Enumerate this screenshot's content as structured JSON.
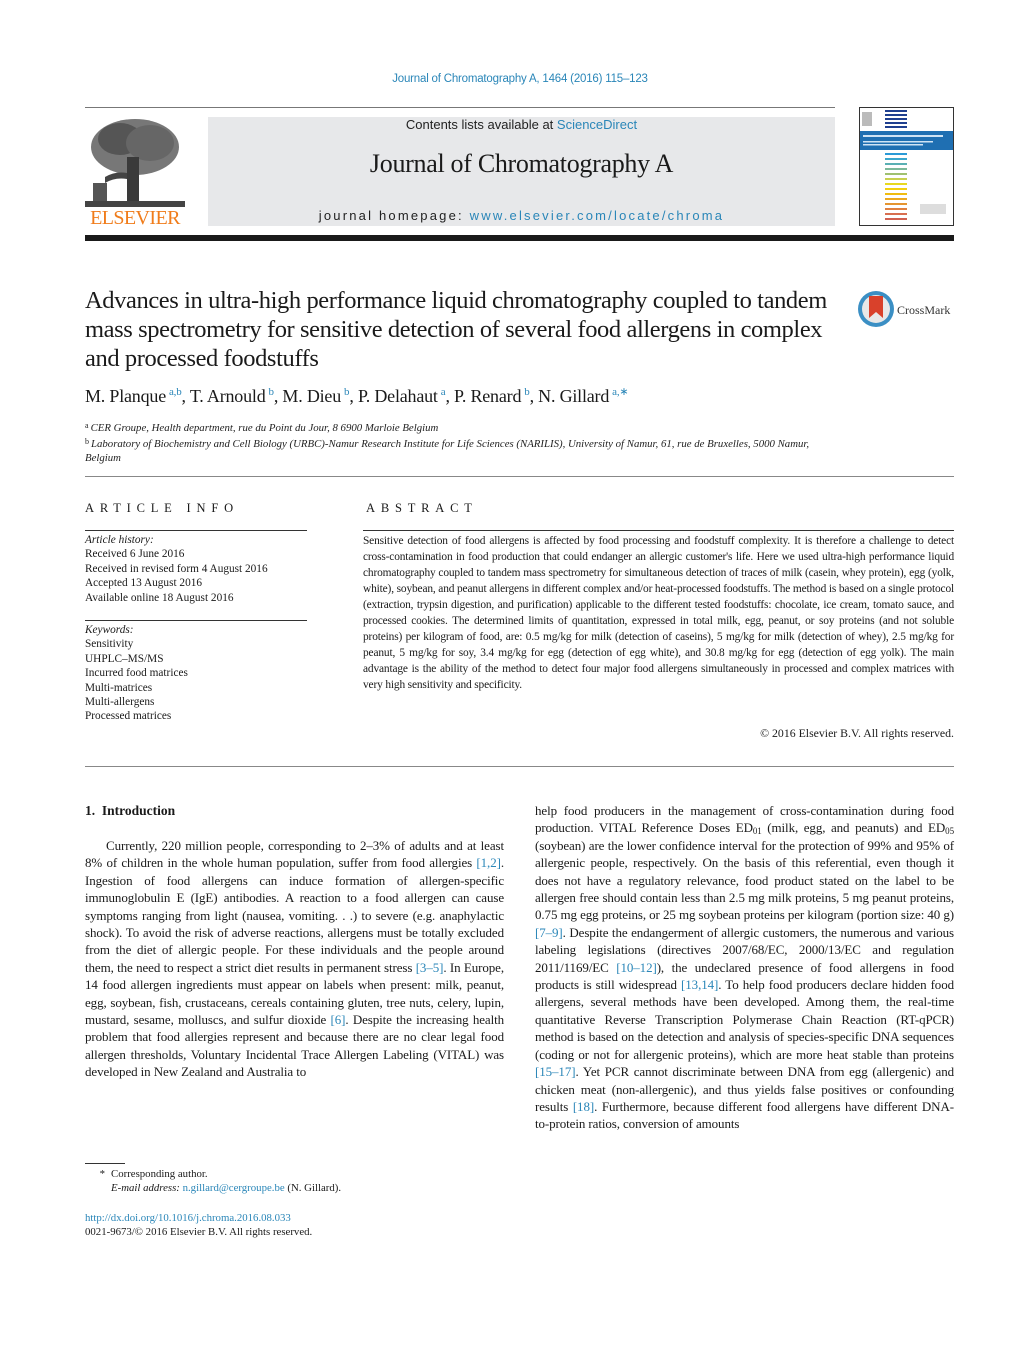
{
  "header": {
    "citation": "Journal of Chromatography A, 1464 (2016) 115–123",
    "publisher_logo_text": "ELSEVIER",
    "contents_prefix": "Contents lists available at ",
    "contents_link": "ScienceDirect",
    "journal_name": "Journal of Chromatography A",
    "homepage_prefix": "journal homepage: ",
    "homepage_link": "www.elsevier.com/locate/chroma",
    "colors": {
      "link": "#2a86b8",
      "elsevier_orange": "#f07c1a",
      "masthead_bg": "#e7e8ea"
    }
  },
  "article": {
    "title": "Advances in ultra-high performance liquid chromatography coupled to tandem mass spectrometry for sensitive detection of several food allergens in complex and processed foodstuffs",
    "crossmark_label": "CrossMark",
    "authors": [
      {
        "name": "M. Planque",
        "aff": "a,b"
      },
      {
        "name": "T. Arnould",
        "aff": "b"
      },
      {
        "name": "M. Dieu",
        "aff": "b"
      },
      {
        "name": "P. Delahaut",
        "aff": "a"
      },
      {
        "name": "P. Renard",
        "aff": "b"
      },
      {
        "name": "N. Gillard",
        "aff": "a,∗"
      }
    ],
    "affiliations": [
      {
        "mark": "a",
        "text": "CER Groupe, Health department, rue du Point du Jour, 8 6900 Marloie Belgium"
      },
      {
        "mark": "b",
        "text": "Laboratory of Biochemistry and Cell Biology (URBC)-Namur Research Institute for Life Sciences (NARILIS), University of Namur, 61, rue de Bruxelles, 5000 Namur, Belgium"
      }
    ]
  },
  "article_info": {
    "heading": "ARTICLE INFO",
    "history_label": "Article history:",
    "history": [
      "Received 6 June 2016",
      "Received in revised form 4 August 2016",
      "Accepted 13 August 2016",
      "Available online 18 August 2016"
    ],
    "keywords_label": "Keywords:",
    "keywords": [
      "Sensitivity",
      "UHPLC–MS/MS",
      "Incurred food matrices",
      "Multi-matrices",
      "Multi-allergens",
      "Processed matrices"
    ]
  },
  "abstract": {
    "heading": "ABSTRACT",
    "text": "Sensitive detection of food allergens is affected by food processing and foodstuff complexity. It is therefore a challenge to detect cross-contamination in food production that could endanger an allergic customer's life. Here we used ultra-high performance liquid chromatography coupled to tandem mass spectrometry for simultaneous detection of traces of milk (casein, whey protein), egg (yolk, white), soybean, and peanut allergens in different complex and/or heat-processed foodstuffs. The method is based on a single protocol (extraction, trypsin digestion, and purification) applicable to the different tested foodstuffs: chocolate, ice cream, tomato sauce, and processed cookies. The determined limits of quantitation, expressed in total milk, egg, peanut, or soy proteins (and not soluble proteins) per kilogram of food, are: 0.5 mg/kg for milk (detection of caseins), 5 mg/kg for milk (detection of whey), 2.5 mg/kg for peanut, 5 mg/kg for soy, 3.4 mg/kg for egg (detection of egg white), and 30.8 mg/kg for egg (detection of egg yolk). The main advantage is the ability of the method to detect four major food allergens simultaneously in processed and complex matrices with very high sensitivity and specificity.",
    "copyright": "© 2016 Elsevier B.V. All rights reserved."
  },
  "introduction": {
    "heading": "1.  Introduction",
    "left": [
      {
        "t": "Currently, 220 million people, corresponding to 2–3% of adults and at least 8% of children in the whole human population, suffer from food allergies "
      },
      {
        "ref": "[1,2]"
      },
      {
        "t": ". Ingestion of food allergens can induce formation of allergen-specific immunoglobulin E (IgE) antibodies. A reaction to a food allergen can cause symptoms ranging from light (nausea, vomiting. . .) to severe (e.g. anaphylactic shock). To avoid the risk of adverse reactions, allergens must be totally excluded from the diet of allergic people. For these individuals and the people around them, the need to respect a strict diet results in permanent stress "
      },
      {
        "ref": "[3–5]"
      },
      {
        "t": ". In Europe, 14 food allergen ingredients must appear on labels when present: milk, peanut, egg, soybean, fish, crustaceans, cereals containing gluten, tree nuts, celery, lupin, mustard, sesame, molluscs, and sulfur dioxide "
      },
      {
        "ref": "[6]"
      },
      {
        "t": ". Despite the increasing health problem that food allergies represent and because there are no clear legal food allergen thresholds, Voluntary Incidental Trace Allergen Labeling (VITAL) was developed in New Zealand and Australia to"
      }
    ],
    "right": [
      {
        "t": "help food producers in the management of cross-contamination during food production. VITAL Reference Doses ED"
      },
      {
        "sub": "01"
      },
      {
        "t": " (milk, egg, and peanuts) and ED"
      },
      {
        "sub": "05"
      },
      {
        "t": " (soybean) are the lower confidence interval for the protection of 99% and 95% of allergenic people, respectively. On the basis of this referential, even though it does not have a regulatory relevance, food product stated on the label to be allergen free should contain less than 2.5 mg milk proteins, 5 mg peanut proteins, 0.75 mg egg proteins, or 25 mg soybean proteins per kilogram (portion size: 40 g) "
      },
      {
        "ref": "[7–9]"
      },
      {
        "t": ". Despite the endangerment of allergic customers, the numerous and various labeling legislations (directives 2007/68/EC, 2000/13/EC and regulation 2011/1169/EC "
      },
      {
        "ref": "[10–12]"
      },
      {
        "t": "), the undeclared presence of food allergens in food products is still widespread "
      },
      {
        "ref": "[13,14]"
      },
      {
        "t": ". To help food producers declare hidden food allergens, several methods have been developed. Among them, the real-time quantitative Reverse Transcription Polymerase Chain Reaction (RT-qPCR) method is based on the detection and analysis of species-specific DNA sequences (coding or not for allergenic proteins), which are more heat stable than proteins "
      },
      {
        "ref": "[15–17]"
      },
      {
        "t": ". Yet PCR cannot discriminate between DNA from egg (allergenic) and chicken meat (non-allergenic), and thus yields false positives or confounding results "
      },
      {
        "ref": "[18]"
      },
      {
        "t": ". Furthermore, because different food allergens have different DNA-to-protein ratios, conversion of amounts"
      }
    ]
  },
  "footnotes": {
    "star": "*",
    "corresponding": "Corresponding author.",
    "email_label": "E-mail address: ",
    "email": "n.gillard@cergroupe.be",
    "email_suffix": " (N. Gillard).",
    "doi": "http://dx.doi.org/10.1016/j.chroma.2016.08.033",
    "issn": "0021-9673/© 2016 Elsevier B.V. All rights reserved."
  }
}
